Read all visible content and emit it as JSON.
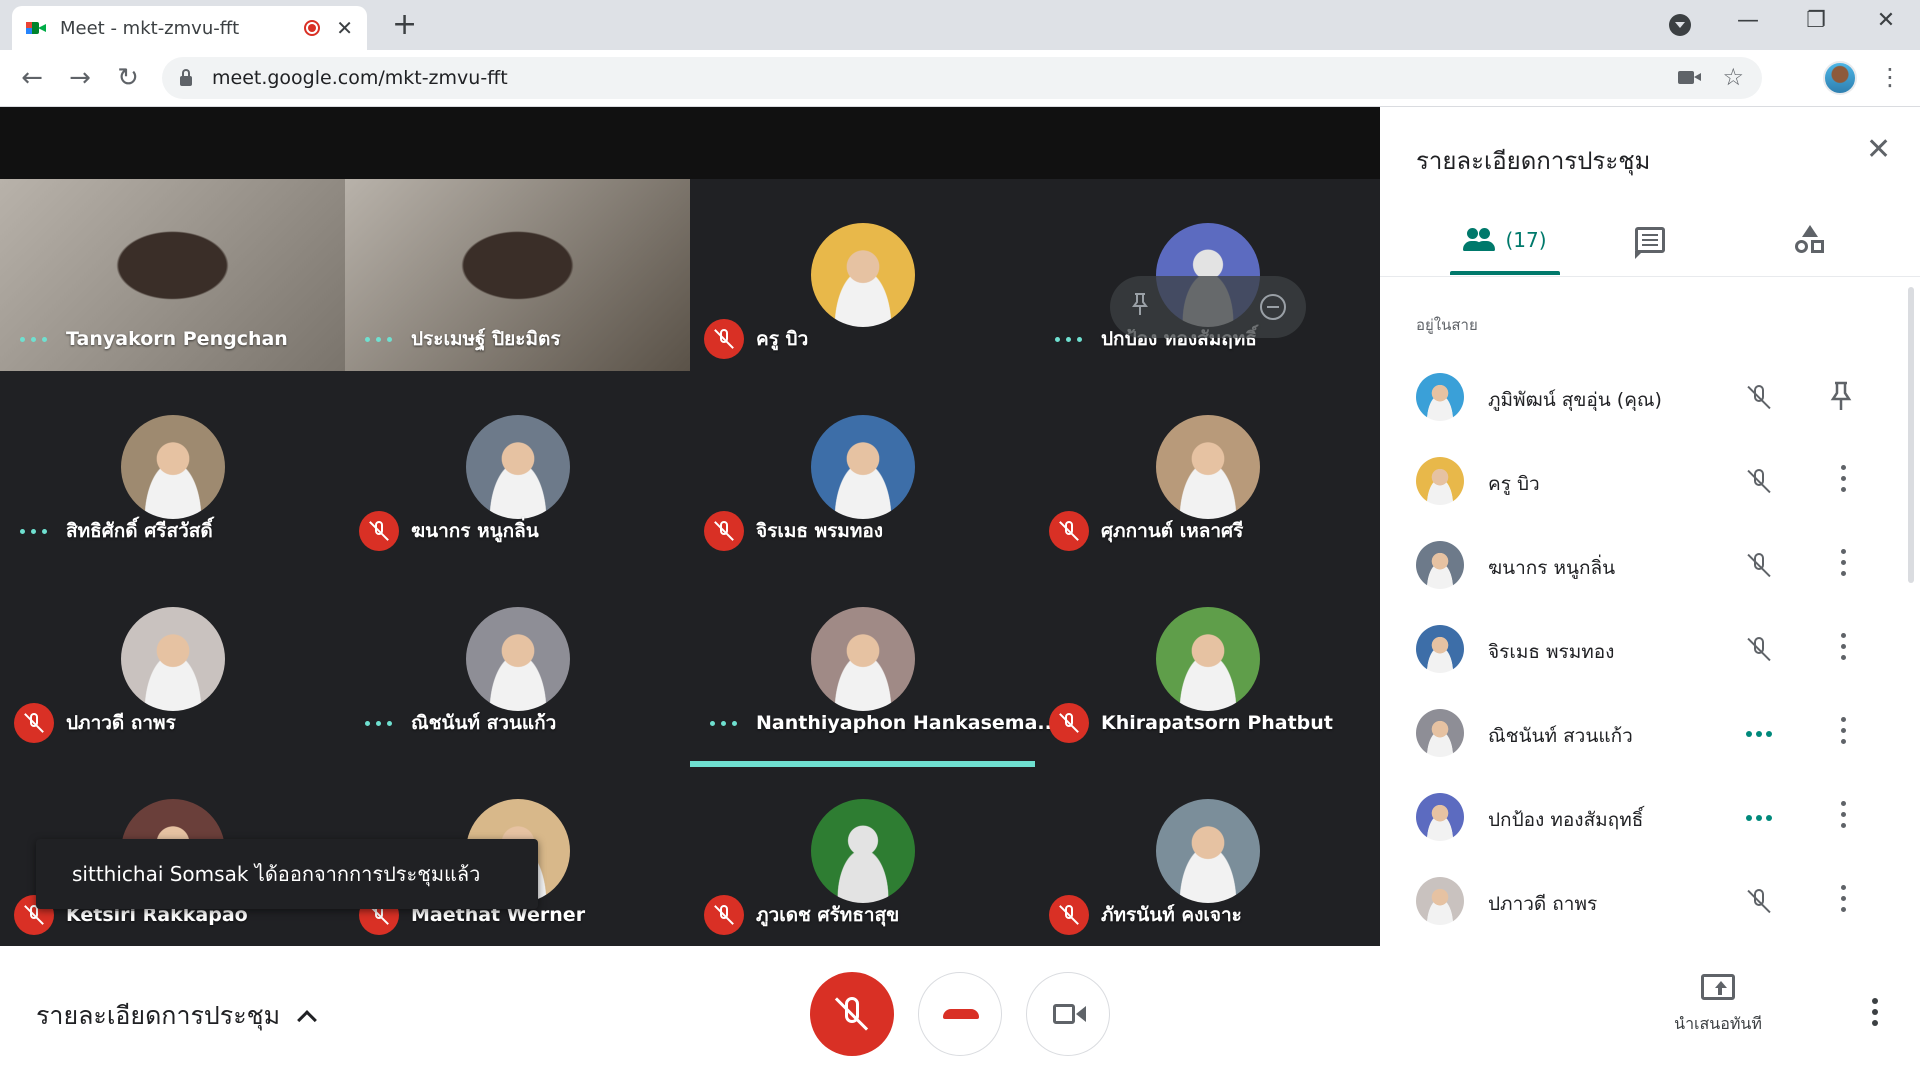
{
  "browser": {
    "tab_title": "Meet - mkt-zmvu-fft",
    "tab_close": "✕",
    "new_tab": "+",
    "url": "meet.google.com/mkt-zmvu-fft",
    "minimize": "—",
    "restore": "❐",
    "close": "✕",
    "back": "←",
    "forward": "→",
    "reload": "↻",
    "star": "☆",
    "menu": "⋮"
  },
  "tiles": [
    {
      "name": "Tanyakorn Pengchan",
      "status": "speaking-dots",
      "type": "video",
      "bg": "#7a746c"
    },
    {
      "name": "ประเมษฐ์ ปิยะมิตร",
      "status": "speaking-dots",
      "type": "video",
      "bg": "#5a5248"
    },
    {
      "name": "ครู บิว",
      "status": "muted",
      "type": "avatar",
      "bg": "#e8b84a"
    },
    {
      "name": "ปกป้อง ทองสัมฤทธิ์",
      "status": "speaking-dots",
      "type": "avatar-default",
      "bg": "#5c6bc0"
    },
    {
      "name": "สิทธิศักดิ์ ศรีสวัสดิ์",
      "status": "speaking-dots",
      "type": "avatar",
      "bg": "#9e8a70"
    },
    {
      "name": "ฆนากร หนูกลิ่น",
      "status": "muted",
      "type": "avatar",
      "bg": "#6d7a8a"
    },
    {
      "name": "จิรเมธ พรมทอง",
      "status": "muted",
      "type": "avatar",
      "bg": "#3d6ea8"
    },
    {
      "name": "ศุภกานต์ เหลาศรี",
      "status": "muted",
      "type": "avatar",
      "bg": "#b89a7a"
    },
    {
      "name": "ปภาวดี ถาพร",
      "status": "muted",
      "type": "avatar",
      "bg": "#c9c2bf"
    },
    {
      "name": "ณิชนันท์ สวนแก้ว",
      "status": "speaking-dots",
      "type": "avatar",
      "bg": "#8e8e96"
    },
    {
      "name": "Nanthiyaphon Hankasema...",
      "status": "speaking-dots",
      "type": "avatar",
      "bg": "#a08a86",
      "active_speaker": true
    },
    {
      "name": "Khirapatsorn Phatbut",
      "status": "muted",
      "type": "avatar",
      "bg": "#5f9e4a"
    },
    {
      "name": "Ketsiri Rakkapao",
      "status": "muted",
      "type": "avatar",
      "bg": "#6a3f3a"
    },
    {
      "name": "Maethat Werner",
      "status": "muted",
      "type": "avatar",
      "bg": "#d8b88a"
    },
    {
      "name": "ภูวเดช ศรัทธาสุข",
      "status": "muted",
      "type": "avatar-default",
      "bg": "#2e7d32"
    },
    {
      "name": "ภัทรนันท์ คงเจาะ",
      "status": "muted",
      "type": "avatar",
      "bg": "#7b8e9a"
    }
  ],
  "toast": {
    "text": "sitthichai Somsak ได้ออกจากการประชุมแล้ว"
  },
  "panel": {
    "title": "รายละเอียดการประชุม",
    "close": "✕",
    "people_count": "(17)",
    "section_label": "อยู่ในสาย",
    "participants": [
      {
        "name": "ภูมิพัฒน์ สุขอุ่น (คุณ)",
        "status": "muted",
        "action": "pin",
        "bg": "#3aa0d8"
      },
      {
        "name": "ครู บิว",
        "status": "muted",
        "action": "more",
        "bg": "#e8b84a"
      },
      {
        "name": "ฆนากร หนูกลิ่น",
        "status": "muted",
        "action": "more",
        "bg": "#6d7a8a"
      },
      {
        "name": "จิรเมธ พรมทอง",
        "status": "muted",
        "action": "more",
        "bg": "#3d6ea8"
      },
      {
        "name": "ณิชนันท์ สวนแก้ว",
        "status": "speaking-dots",
        "action": "more",
        "bg": "#8e8e96"
      },
      {
        "name": "ปกป้อง ทองสัมฤทธิ์",
        "status": "speaking-dots",
        "action": "more",
        "bg": "#5c6bc0"
      },
      {
        "name": "ปภาวดี ถาพร",
        "status": "muted",
        "action": "more",
        "bg": "#c9c2bf"
      }
    ]
  },
  "bottom": {
    "meeting_details": "รายละเอียดการประชุม",
    "present_label": "นำเสนอทันที"
  },
  "colors": {
    "accent": "#00796b",
    "danger": "#d93025",
    "speaking": "#6fe0d0"
  }
}
